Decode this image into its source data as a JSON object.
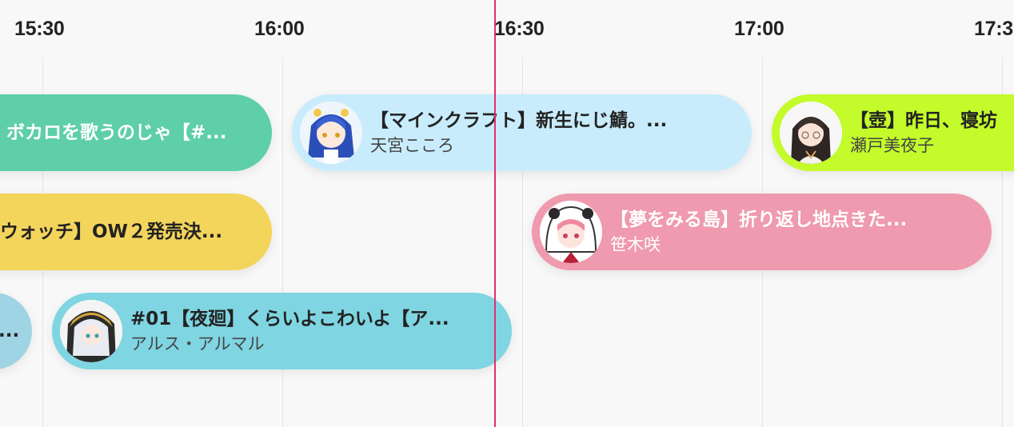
{
  "timeline": {
    "times": [
      "15:30",
      "16:00",
      "16:30",
      "17:00",
      "17:3"
    ]
  },
  "cards": {
    "c1": {
      "title": "ボカロを歌うのじゃ【#...",
      "color": "#5ecfa8"
    },
    "c2": {
      "title": "ウォッチ】OW２発売決...",
      "color": "#f3d55c"
    },
    "c3": {
      "title": "...",
      "color": "#9fd4e4"
    },
    "c4": {
      "title": "【マインクラフト】新生にじ鯖。...",
      "channel": "天宮こころ",
      "color": "#c8ecfb",
      "avatar": "avatar-blue-hair-girl"
    },
    "c5": {
      "title": "【夢をみる島】折り返し地点きた...",
      "channel": "笹木咲",
      "color": "#ef9aae",
      "avatar": "avatar-panda-hood-girl"
    },
    "c6": {
      "title": "#01【夜廻】くらいよこわいよ【ア...",
      "channel": "アルス・アルマル",
      "color": "#7fd5e2",
      "avatar": "avatar-white-hair-hood"
    },
    "c7": {
      "title": "【壺】昨日、寝坊",
      "channel": "瀬戸美夜子",
      "color": "#c3fb2b",
      "avatar": "avatar-glasses-woman"
    }
  }
}
